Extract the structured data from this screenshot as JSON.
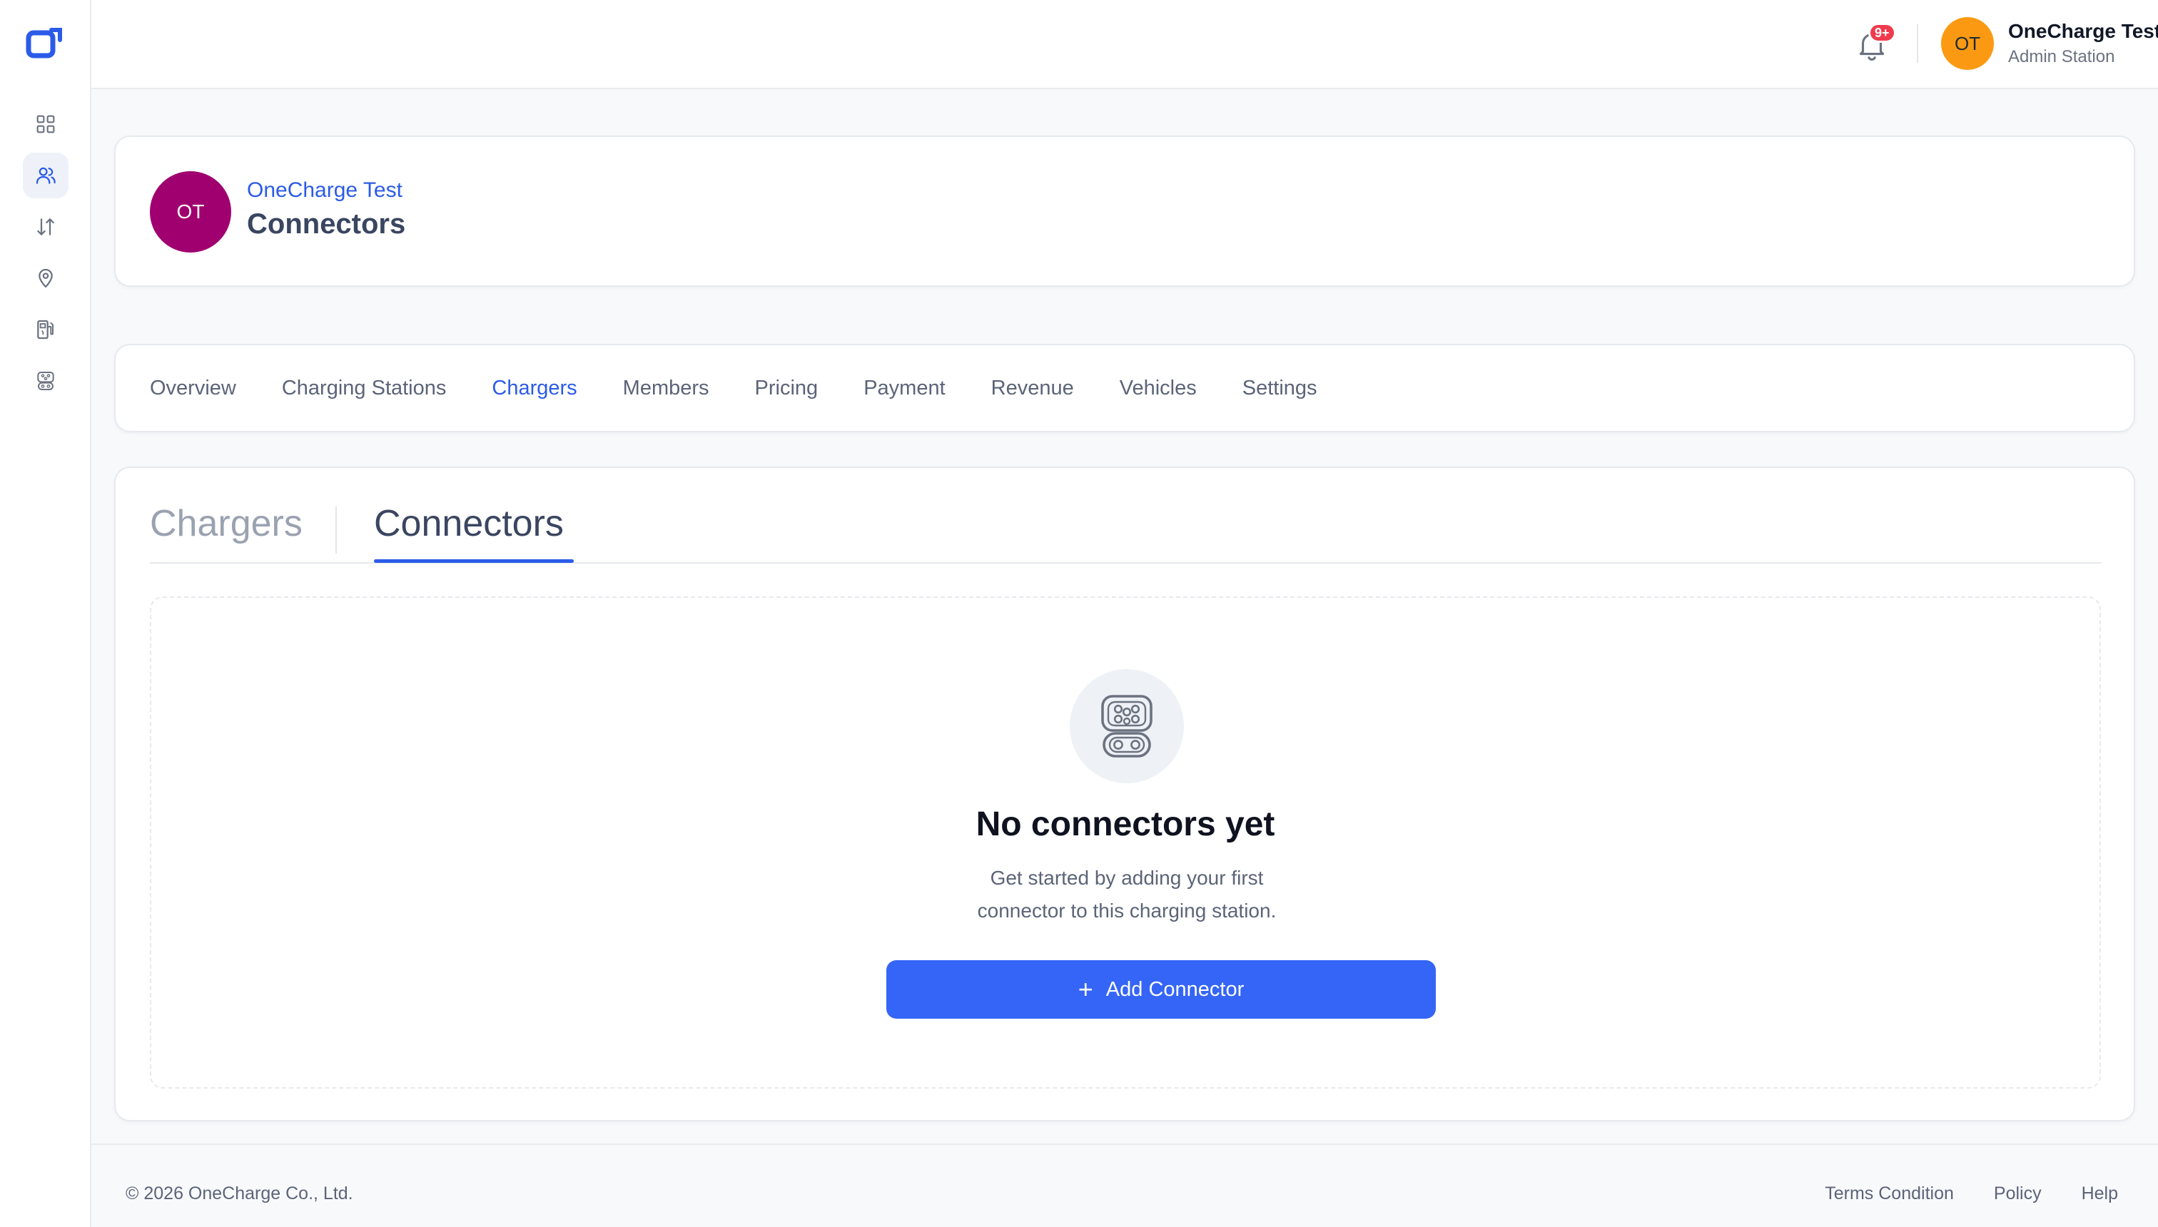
{
  "brand": {
    "accent": "#2b5be8",
    "button": "#3565f6"
  },
  "sidebar": {
    "items": [
      {
        "icon": "dashboard-grid-icon",
        "active": false
      },
      {
        "icon": "users-icon",
        "active": true
      },
      {
        "icon": "transactions-arrows-icon",
        "active": false
      },
      {
        "icon": "location-pin-icon",
        "active": false
      },
      {
        "icon": "ev-station-icon",
        "active": false
      },
      {
        "icon": "connector-plug-icon",
        "active": false
      }
    ]
  },
  "topbar": {
    "notification_badge": "9+",
    "user": {
      "initials": "OT",
      "name": "OneCharge Test",
      "role": "Admin Station",
      "avatar_color": "#fb9a12"
    }
  },
  "header": {
    "initials": "OT",
    "avatar_color": "#a0006f",
    "subtitle": "OneCharge Test",
    "title": "Connectors"
  },
  "main_tabs": [
    {
      "label": "Overview",
      "active": false
    },
    {
      "label": "Charging Stations",
      "active": false
    },
    {
      "label": "Chargers",
      "active": true
    },
    {
      "label": "Members",
      "active": false
    },
    {
      "label": "Pricing",
      "active": false
    },
    {
      "label": "Payment",
      "active": false
    },
    {
      "label": "Revenue",
      "active": false
    },
    {
      "label": "Vehicles",
      "active": false
    },
    {
      "label": "Settings",
      "active": false
    }
  ],
  "sub_tabs": {
    "chargers": "Chargers",
    "connectors": "Connectors",
    "active": "connectors"
  },
  "empty_state": {
    "icon": "connector-plug-icon",
    "title": "No connectors yet",
    "description": "Get started by adding your first connector to this charging station.",
    "button_label": "Add Connector"
  },
  "footer": {
    "copyright": "© 2026 OneCharge Co., Ltd.",
    "links": [
      "Terms Condition",
      "Policy",
      "Help"
    ]
  }
}
